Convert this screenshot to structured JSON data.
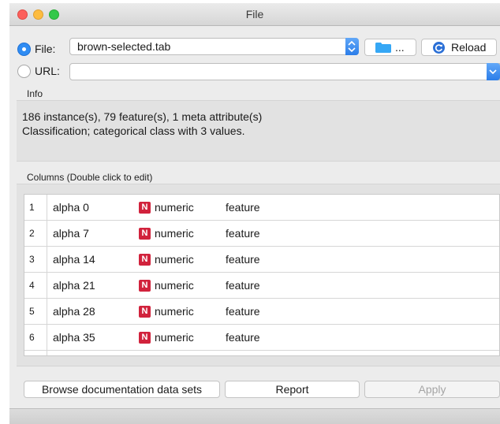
{
  "window": {
    "title": "File"
  },
  "source": {
    "file_label": "File:",
    "file_value": "brown-selected.tab",
    "browse_label": "...",
    "reload_label": "Reload",
    "url_label": "URL:",
    "url_value": ""
  },
  "info": {
    "label": "Info",
    "line1": "186 instance(s), 79 feature(s), 1 meta attribute(s)",
    "line2": "Classification; categorical class with 3 values."
  },
  "columns": {
    "label": "Columns (Double click to edit)",
    "rows": [
      {
        "index": "1",
        "name": "alpha 0",
        "type_icon": "N",
        "type": "numeric",
        "role": "feature"
      },
      {
        "index": "2",
        "name": "alpha 7",
        "type_icon": "N",
        "type": "numeric",
        "role": "feature"
      },
      {
        "index": "3",
        "name": "alpha 14",
        "type_icon": "N",
        "type": "numeric",
        "role": "feature"
      },
      {
        "index": "4",
        "name": "alpha 21",
        "type_icon": "N",
        "type": "numeric",
        "role": "feature"
      },
      {
        "index": "5",
        "name": "alpha 28",
        "type_icon": "N",
        "type": "numeric",
        "role": "feature"
      },
      {
        "index": "6",
        "name": "alpha 35",
        "type_icon": "N",
        "type": "numeric",
        "role": "feature"
      }
    ]
  },
  "footer": {
    "browse_docs_label": "Browse documentation data sets",
    "report_label": "Report",
    "apply_label": "Apply"
  },
  "colors": {
    "accent": "#2f8cf3",
    "numeric_badge": "#d1223c",
    "folder": "#35a7f5",
    "reload_icon": "#2a6fd6"
  }
}
